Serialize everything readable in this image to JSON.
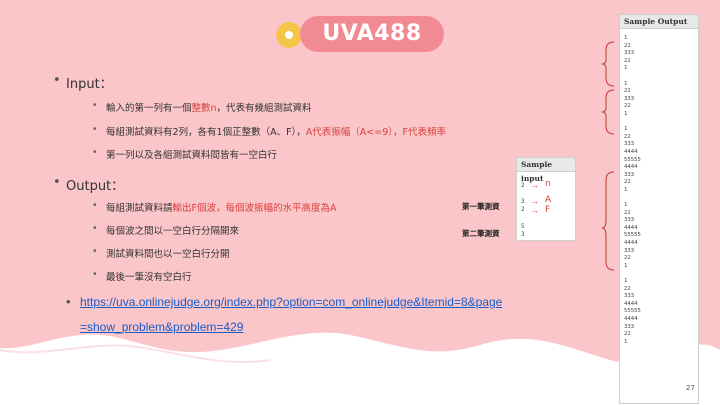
{
  "title": "UVA488",
  "input_section": {
    "heading": "Input：",
    "items": [
      {
        "pre": "輸入的第一列有一個",
        "red": "整數n",
        "post": "，代表有幾組測試資料"
      },
      {
        "pre": "每組測試資料有2列，各有1個正整數（A、F），",
        "red": "A代表振幅（A<=9），F代表頻率",
        "post": ""
      },
      {
        "pre": "第一列以及各組測試資料間皆有一空白行",
        "red": "",
        "post": ""
      }
    ]
  },
  "output_section": {
    "heading": "Output：",
    "items": [
      {
        "pre": "每組測試資料請",
        "red": "輸出F個波，每個波振幅的水平高度為A",
        "post": ""
      },
      {
        "pre": "每個波之間以一空白行分隔開來",
        "red": "",
        "post": ""
      },
      {
        "pre": "測試資料間也以一空白行分開",
        "red": "",
        "post": ""
      },
      {
        "pre": "最後一筆沒有空白行",
        "red": "",
        "post": ""
      }
    ]
  },
  "link": {
    "line1": "https://uva.onlinejudge.org/index.php?option=com_onlinejudge&Itemid=8&page",
    "line2": "=show_problem&problem=429"
  },
  "case_labels": [
    "第一筆測資",
    "第二筆測資"
  ],
  "sample_input": {
    "header": "Sample input",
    "lines": [
      "2",
      "3",
      "2",
      "5",
      "3"
    ],
    "annotations": [
      "n",
      "A",
      "F"
    ]
  },
  "sample_output": {
    "header": "Sample Output",
    "text": "1\n22\n333\n22\n1\n\n1\n22\n333\n22\n1\n\n1\n22\n333\n4444\n55555\n4444\n333\n22\n1\n\n1\n22\n333\n4444\n55555\n4444\n333\n22\n1\n\n1\n22\n333\n4444\n55555\n4444\n333\n22\n1"
  },
  "page_number": "27",
  "colors": {
    "accent_pink": "#f28a93",
    "accent_yellow": "#f5c54a",
    "highlight_red": "#d9413c",
    "bracket_red": "#c0392b"
  }
}
